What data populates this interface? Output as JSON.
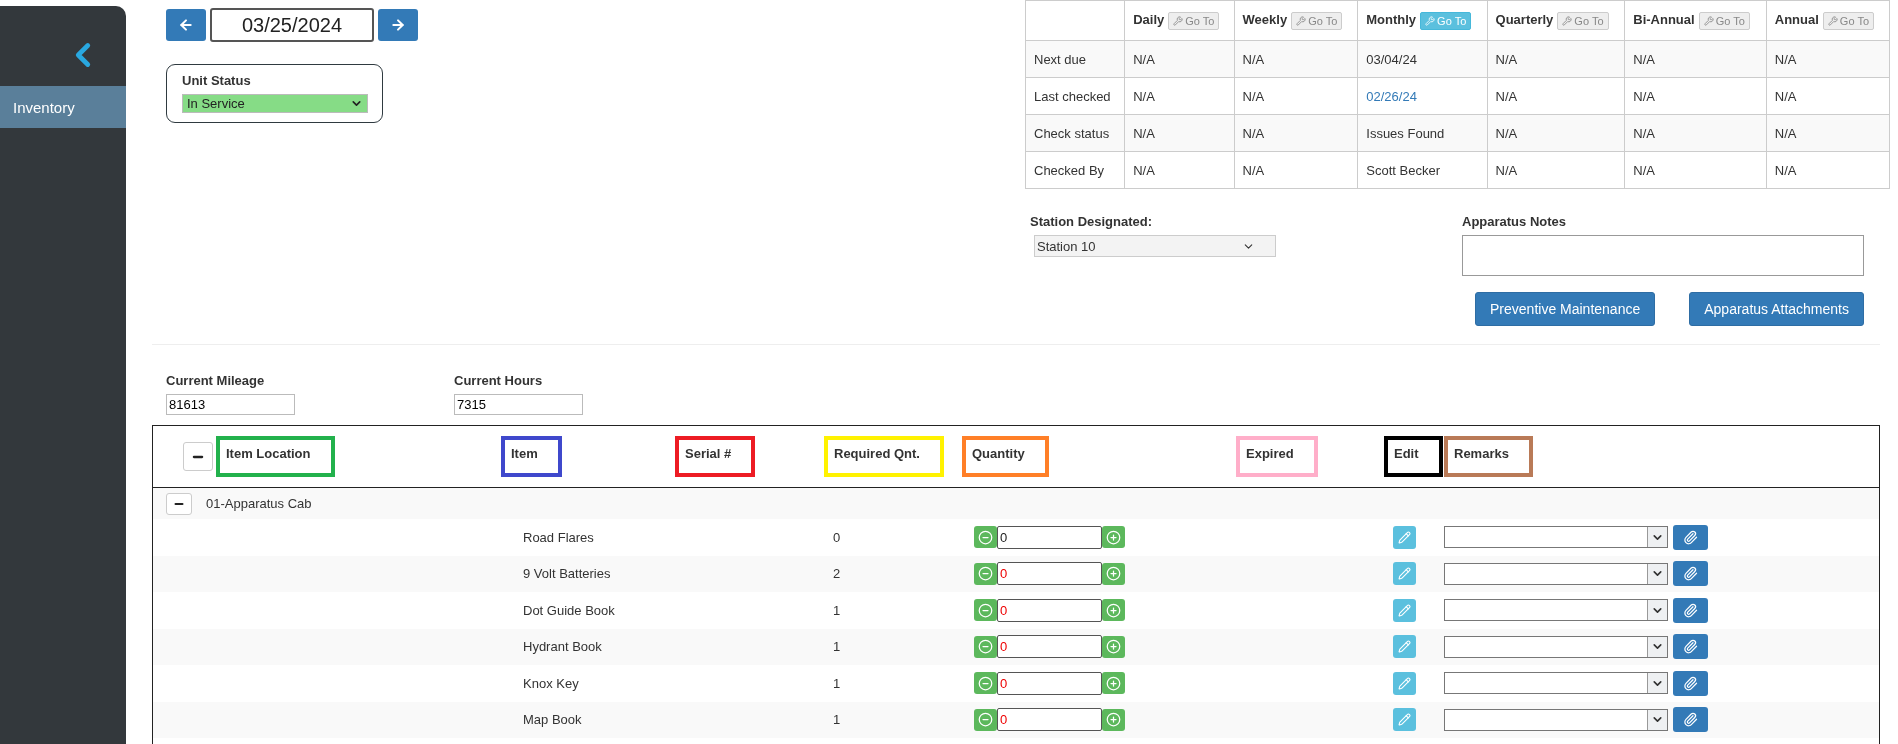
{
  "sidebar": {
    "items": [
      {
        "label": "Inventory",
        "selected": true
      }
    ]
  },
  "date_picker": {
    "value": "03/25/2024"
  },
  "unit_status": {
    "label": "Unit Status",
    "value": "In Service"
  },
  "schedule": {
    "frequencies": [
      {
        "label": "Daily",
        "button": "Go To",
        "active": false
      },
      {
        "label": "Weekly",
        "button": "Go To",
        "active": false
      },
      {
        "label": "Monthly",
        "button": "Go To",
        "active": true
      },
      {
        "label": "Quarterly",
        "button": "Go To",
        "active": false
      },
      {
        "label": "Bi-Annual",
        "button": "Go To",
        "active": false
      },
      {
        "label": "Annual",
        "button": "Go To",
        "active": false
      }
    ],
    "rows": [
      {
        "label": "Next due",
        "cells": [
          {
            "text": "N/A",
            "link": false
          },
          {
            "text": "N/A",
            "link": false
          },
          {
            "text": "03/04/24",
            "link": false
          },
          {
            "text": "N/A",
            "link": false
          },
          {
            "text": "N/A",
            "link": false
          },
          {
            "text": "N/A",
            "link": false
          }
        ]
      },
      {
        "label": "Last checked",
        "cells": [
          {
            "text": "N/A",
            "link": false
          },
          {
            "text": "N/A",
            "link": false
          },
          {
            "text": "02/26/24",
            "link": true
          },
          {
            "text": "N/A",
            "link": false
          },
          {
            "text": "N/A",
            "link": false
          },
          {
            "text": "N/A",
            "link": false
          }
        ]
      },
      {
        "label": "Check status",
        "cells": [
          {
            "text": "N/A",
            "link": false
          },
          {
            "text": "N/A",
            "link": false
          },
          {
            "text": "Issues Found",
            "link": false
          },
          {
            "text": "N/A",
            "link": false
          },
          {
            "text": "N/A",
            "link": false
          },
          {
            "text": "N/A",
            "link": false
          }
        ]
      },
      {
        "label": "Checked By",
        "cells": [
          {
            "text": "N/A",
            "link": false
          },
          {
            "text": "N/A",
            "link": false
          },
          {
            "text": "Scott Becker",
            "link": false
          },
          {
            "text": "N/A",
            "link": false
          },
          {
            "text": "N/A",
            "link": false
          },
          {
            "text": "N/A",
            "link": false
          }
        ]
      }
    ]
  },
  "station": {
    "label": "Station Designated:",
    "value": "Station 10"
  },
  "notes": {
    "label": "Apparatus Notes"
  },
  "action_buttons": [
    "Preventive Maintenance",
    "Apparatus Attachments"
  ],
  "readings": [
    {
      "label": "Current Mileage",
      "value": "81613"
    },
    {
      "label": "Current Hours",
      "value": "7315"
    }
  ],
  "inventory": {
    "columns": [
      {
        "label": "Item Location",
        "color": "#22b14c"
      },
      {
        "label": "Item",
        "color": "#3f48cc"
      },
      {
        "label": "Serial #",
        "color": "#ed1c24"
      },
      {
        "label": "Required Qnt.",
        "color": "#fff200"
      },
      {
        "label": "Quantity",
        "color": "#ff7f27"
      },
      {
        "label": "Expired",
        "color": "#ffaec9"
      },
      {
        "label": "Edit",
        "color": "#000000"
      },
      {
        "label": "Remarks",
        "color": "#b97a57"
      }
    ],
    "groups": [
      {
        "name": "01-Apparatus Cab",
        "expanded": true,
        "items": [
          {
            "name": "Road Flares",
            "required": "0",
            "quantity": "0",
            "short": false
          },
          {
            "name": "9 Volt Batteries",
            "required": "2",
            "quantity": "0",
            "short": true
          },
          {
            "name": "Dot Guide Book",
            "required": "1",
            "quantity": "0",
            "short": true
          },
          {
            "name": "Hydrant Book",
            "required": "1",
            "quantity": "0",
            "short": true
          },
          {
            "name": "Knox Key",
            "required": "1",
            "quantity": "0",
            "short": true
          },
          {
            "name": "Map Book",
            "required": "1",
            "quantity": "0",
            "short": true
          }
        ]
      }
    ]
  }
}
